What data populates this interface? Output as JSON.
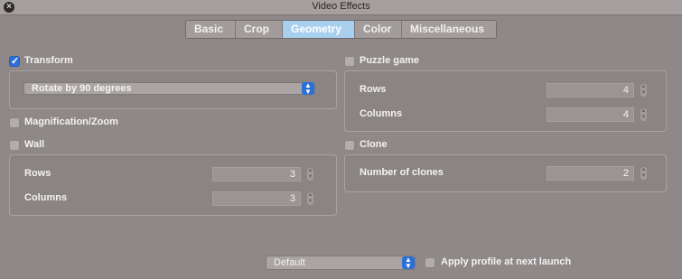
{
  "window": {
    "title": "Video Effects",
    "close_icon": "close-icon"
  },
  "tabs": [
    {
      "label": "Basic",
      "active": false
    },
    {
      "label": "Crop",
      "active": false
    },
    {
      "label": "Geometry",
      "active": true
    },
    {
      "label": "Color",
      "active": false
    },
    {
      "label": "Miscellaneous",
      "active": false
    }
  ],
  "transform": {
    "label": "Transform",
    "checked": true,
    "popup_value": "Rotate by 90 degrees"
  },
  "magnification": {
    "label": "Magnification/Zoom",
    "checked": false
  },
  "wall": {
    "label": "Wall",
    "checked": false,
    "rows_label": "Rows",
    "rows_value": "3",
    "columns_label": "Columns",
    "columns_value": "3"
  },
  "puzzle": {
    "label": "Puzzle game",
    "checked": false,
    "rows_label": "Rows",
    "rows_value": "4",
    "columns_label": "Columns",
    "columns_value": "4"
  },
  "clone": {
    "label": "Clone",
    "checked": false,
    "clones_label": "Number of clones",
    "clones_value": "2"
  },
  "footer": {
    "profile_value": "Default",
    "apply_label": "Apply profile at next launch",
    "apply_checked": false
  },
  "colors": {
    "accent": "#2c6fd6",
    "active_tab": "#a9cfef",
    "background": "#8f8888"
  }
}
